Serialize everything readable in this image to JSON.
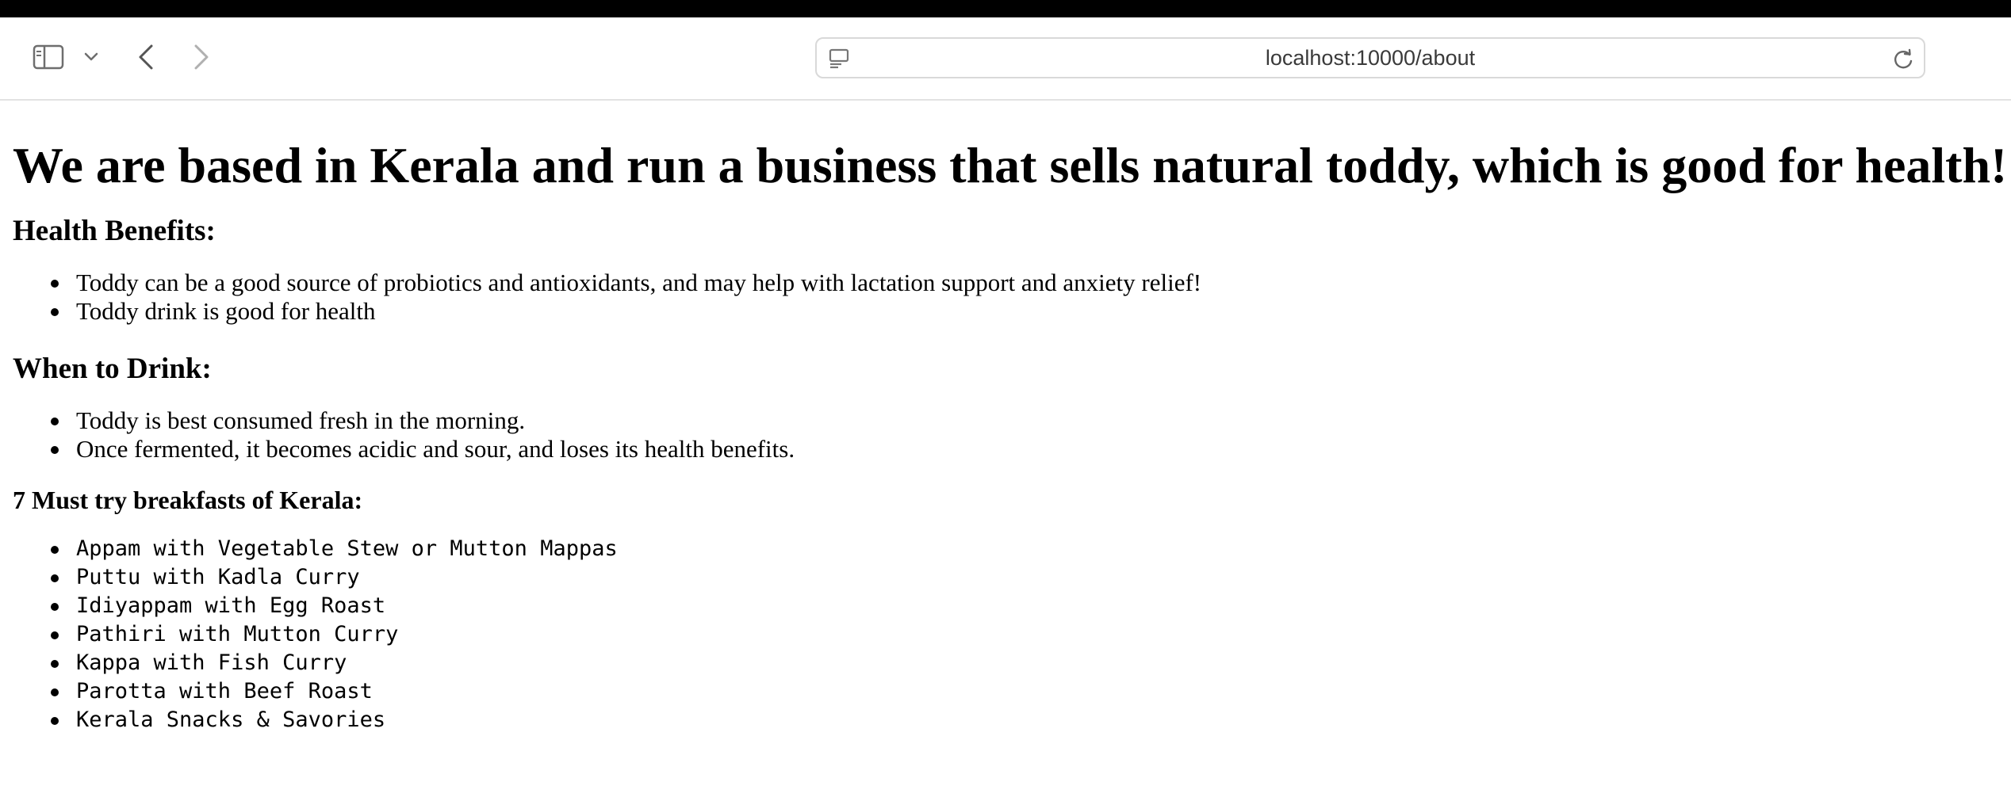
{
  "browser": {
    "url": "localhost:10000/about",
    "icons": {
      "sidebar": "sidebar-icon",
      "chevron": "chevron-down-icon",
      "back": "back-arrow-icon",
      "forward": "forward-arrow-icon",
      "site": "site-info-icon",
      "reload": "reload-icon"
    }
  },
  "page": {
    "title": "We are based in Kerala and run a business that sells natural toddy, which is good for health!",
    "health": {
      "heading": "Health Benefits:",
      "items": [
        "Toddy can be a good source of probiotics and antioxidants, and may help with lactation support and anxiety relief!",
        "Toddy drink is good for health"
      ]
    },
    "when": {
      "heading": "When to Drink:",
      "items": [
        "Toddy is best consumed fresh in the morning.",
        "Once fermented, it becomes acidic and sour, and loses its health benefits."
      ]
    },
    "breakfasts": {
      "heading": "7 Must try breakfasts of Kerala:",
      "items": [
        "Appam with Vegetable Stew or Mutton Mappas",
        "Puttu with Kadla Curry",
        "Idiyappam with Egg Roast",
        "Pathiri with Mutton Curry",
        "Kappa with Fish Curry",
        "Parotta with Beef Roast",
        "Kerala Snacks & Savories"
      ]
    }
  }
}
